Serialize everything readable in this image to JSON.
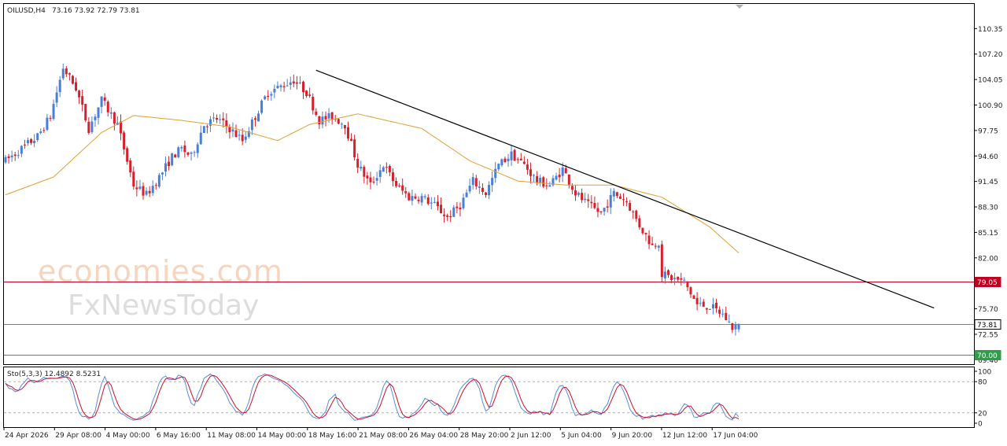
{
  "header": {
    "symbol_tf": "OILUSD,H4",
    "ohlc": "73.16 73.92 72.79 73.81"
  },
  "watermark": {
    "line1": "economies.com",
    "line2": "FxNewsToday"
  },
  "price_axis": {
    "ticks": [
      "110.35",
      "107.20",
      "104.05",
      "100.90",
      "97.75",
      "94.60",
      "91.45",
      "88.30",
      "85.15",
      "82.00",
      "75.70",
      "72.55",
      "69.40"
    ],
    "tick_values": [
      110.35,
      107.2,
      104.05,
      100.9,
      97.75,
      94.6,
      91.45,
      88.3,
      85.15,
      82.0,
      75.7,
      72.55,
      69.4
    ],
    "range": [
      68.85,
      113.4
    ]
  },
  "levels": [
    {
      "label": "79.05",
      "value": 79.05,
      "color": "#c00020"
    },
    {
      "label": "73.81",
      "value": 73.81,
      "color": "#808080"
    },
    {
      "label": "70.00",
      "value": 70.0,
      "color": "#2e9e4a"
    }
  ],
  "stoch": {
    "label": "Sto(5,3,3) 12.4892 8.5231",
    "ticks": [
      "100",
      "80",
      "20",
      "0"
    ],
    "tick_values": [
      100,
      80,
      20,
      0
    ]
  },
  "time_axis": {
    "labels": [
      "24 Apr 2026",
      "29 Apr 08:00",
      "4 May 00:00",
      "6 May 16:00",
      "11 May 08:00",
      "14 May 00:00",
      "18 May 16:00",
      "21 May 08:00",
      "26 May 04:00",
      "28 May 20:00",
      "2 Jun 12:00",
      "5 Jun 04:00",
      "9 Jun 20:00",
      "12 Jun 12:00",
      "17 Jun 04:00"
    ]
  },
  "chart_data": {
    "type": "candlestick",
    "symbol": "OILUSD",
    "timeframe": "H4",
    "ylim": [
      68.85,
      113.4
    ],
    "anchors": [
      {
        "i": 0,
        "p": 94.0
      },
      {
        "i": 10,
        "p": 97.0
      },
      {
        "i": 14,
        "p": 99.5
      },
      {
        "i": 18,
        "p": 105.5
      },
      {
        "i": 22,
        "p": 103.0
      },
      {
        "i": 26,
        "p": 98.0
      },
      {
        "i": 30,
        "p": 101.5
      },
      {
        "i": 35,
        "p": 98.5
      },
      {
        "i": 40,
        "p": 91.0
      },
      {
        "i": 44,
        "p": 89.8
      },
      {
        "i": 48,
        "p": 92.0
      },
      {
        "i": 52,
        "p": 94.5
      },
      {
        "i": 55,
        "p": 95.5
      },
      {
        "i": 58,
        "p": 94.5
      },
      {
        "i": 62,
        "p": 98.5
      },
      {
        "i": 66,
        "p": 99.2
      },
      {
        "i": 70,
        "p": 98.0
      },
      {
        "i": 74,
        "p": 96.5
      },
      {
        "i": 78,
        "p": 99.5
      },
      {
        "i": 82,
        "p": 102.5
      },
      {
        "i": 86,
        "p": 103.2
      },
      {
        "i": 90,
        "p": 104.0
      },
      {
        "i": 94,
        "p": 102.5
      },
      {
        "i": 98,
        "p": 99.0
      },
      {
        "i": 102,
        "p": 99.5
      },
      {
        "i": 106,
        "p": 98.5
      },
      {
        "i": 110,
        "p": 93.5
      },
      {
        "i": 114,
        "p": 91.0
      },
      {
        "i": 118,
        "p": 93.5
      },
      {
        "i": 122,
        "p": 91.0
      },
      {
        "i": 126,
        "p": 89.5
      },
      {
        "i": 130,
        "p": 89.5
      },
      {
        "i": 134,
        "p": 88.5
      },
      {
        "i": 138,
        "p": 87.0
      },
      {
        "i": 142,
        "p": 88.5
      },
      {
        "i": 146,
        "p": 91.5
      },
      {
        "i": 150,
        "p": 90.0
      },
      {
        "i": 154,
        "p": 93.5
      },
      {
        "i": 158,
        "p": 94.8
      },
      {
        "i": 162,
        "p": 93.5
      },
      {
        "i": 166,
        "p": 91.5
      },
      {
        "i": 170,
        "p": 91.0
      },
      {
        "i": 174,
        "p": 93.0
      },
      {
        "i": 178,
        "p": 90.0
      },
      {
        "i": 182,
        "p": 88.5
      },
      {
        "i": 186,
        "p": 87.5
      },
      {
        "i": 190,
        "p": 90.0
      },
      {
        "i": 194,
        "p": 89.0
      },
      {
        "i": 198,
        "p": 86.0
      },
      {
        "i": 202,
        "p": 83.5
      },
      {
        "i": 204,
        "p": 84.0
      },
      {
        "i": 205,
        "p": 80.0
      },
      {
        "i": 208,
        "p": 79.5
      },
      {
        "i": 212,
        "p": 79.0
      },
      {
        "i": 216,
        "p": 76.2
      },
      {
        "i": 220,
        "p": 76.0
      },
      {
        "i": 224,
        "p": 75.0
      },
      {
        "i": 227,
        "p": 73.4
      },
      {
        "i": 229,
        "p": 73.81
      }
    ],
    "moving_average": [
      {
        "i": 0,
        "p": 89.8
      },
      {
        "i": 15,
        "p": 92.0
      },
      {
        "i": 30,
        "p": 97.5
      },
      {
        "i": 40,
        "p": 99.6
      },
      {
        "i": 55,
        "p": 99.0
      },
      {
        "i": 70,
        "p": 98.2
      },
      {
        "i": 85,
        "p": 96.5
      },
      {
        "i": 95,
        "p": 98.5
      },
      {
        "i": 110,
        "p": 99.8
      },
      {
        "i": 130,
        "p": 98.0
      },
      {
        "i": 145,
        "p": 94.0
      },
      {
        "i": 160,
        "p": 91.5
      },
      {
        "i": 175,
        "p": 91.0
      },
      {
        "i": 190,
        "p": 91.0
      },
      {
        "i": 205,
        "p": 89.5
      },
      {
        "i": 220,
        "p": 85.8
      },
      {
        "i": 229,
        "p": 82.6
      }
    ],
    "trendline": [
      {
        "i": 97,
        "p": 105.2
      },
      {
        "i": 290,
        "p": 75.8
      }
    ],
    "stochastic": {
      "k": 12.4892,
      "d": 8.5231,
      "overbought": 80,
      "oversold": 20
    }
  }
}
